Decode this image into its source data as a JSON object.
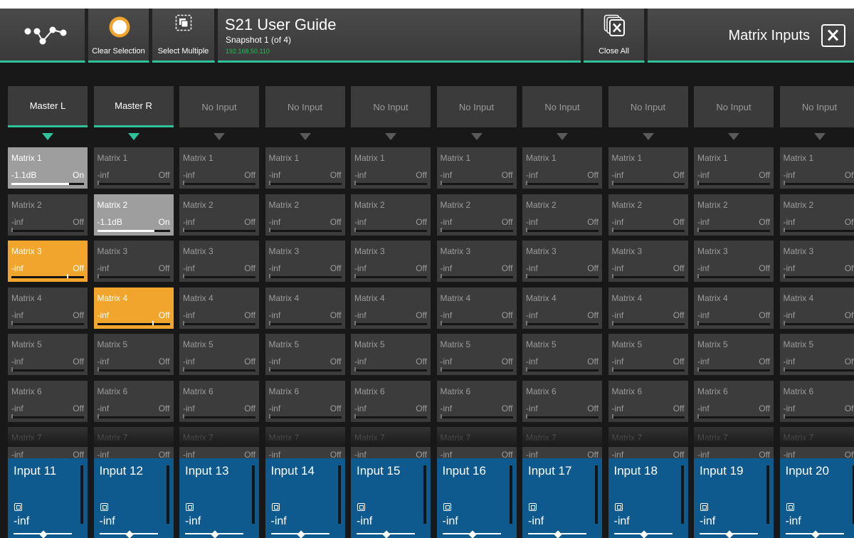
{
  "toolbar": {
    "clear_selection_label": "Clear Selection",
    "select_multiple_label": "Select Multiple",
    "close_all_label": "Close All",
    "title": "S21 User Guide",
    "snapshot": "Snapshot 1 (of 4)",
    "ip_address": "192.168.50.110",
    "panel_title": "Matrix Inputs"
  },
  "colors": {
    "accent": "#2fc39a",
    "selected": "#f2a52d",
    "input_strip": "#0e5a8f",
    "active_cell": "#9e9e9e",
    "cell": "#3c3c3c"
  },
  "icons": [
    "network-icon",
    "clear-selection-icon",
    "select-multiple-icon",
    "close-all-icon",
    "close-icon",
    "channel-icon",
    "arrow-down-icon"
  ],
  "columns": [
    {
      "master": "Master L",
      "master_active": true,
      "cells": [
        {
          "name": "Matrix 1",
          "level": "-1.1dB",
          "state": "On",
          "style": "on",
          "send": 0.79
        },
        {
          "name": "Matrix 2",
          "level": "-inf",
          "state": "Off",
          "style": "normal",
          "send": 0
        },
        {
          "name": "Matrix 3",
          "level": "-inf",
          "state": "Off",
          "style": "selected",
          "send": 0
        },
        {
          "name": "Matrix 4",
          "level": "-inf",
          "state": "Off",
          "style": "normal",
          "send": 0
        },
        {
          "name": "Matrix 5",
          "level": "-inf",
          "state": "Off",
          "style": "normal",
          "send": 0
        },
        {
          "name": "Matrix 6",
          "level": "-inf",
          "state": "Off",
          "style": "normal",
          "send": 0
        },
        {
          "name": "Matrix 7",
          "level": "-inf",
          "state": "Off",
          "style": "normal",
          "send": 0
        }
      ],
      "input": "Input 11",
      "input_level": "-inf"
    },
    {
      "master": "Master R",
      "master_active": true,
      "cells": [
        {
          "name": "Matrix 1",
          "level": "-inf",
          "state": "Off",
          "style": "normal",
          "send": 0
        },
        {
          "name": "Matrix 2",
          "level": "-1.1dB",
          "state": "On",
          "style": "on",
          "send": 0.79
        },
        {
          "name": "Matrix 3",
          "level": "-inf",
          "state": "Off",
          "style": "normal",
          "send": 0
        },
        {
          "name": "Matrix 4",
          "level": "-inf",
          "state": "Off",
          "style": "selected",
          "send": 0
        },
        {
          "name": "Matrix 5",
          "level": "-inf",
          "state": "Off",
          "style": "normal",
          "send": 0
        },
        {
          "name": "Matrix 6",
          "level": "-inf",
          "state": "Off",
          "style": "normal",
          "send": 0
        },
        {
          "name": "Matrix 7",
          "level": "-inf",
          "state": "Off",
          "style": "normal",
          "send": 0
        }
      ],
      "input": "Input 12",
      "input_level": "-inf"
    },
    {
      "master": "No Input",
      "master_active": false,
      "cells": [
        {
          "name": "Matrix 1",
          "level": "-inf",
          "state": "Off",
          "style": "normal",
          "send": 0
        },
        {
          "name": "Matrix 2",
          "level": "-inf",
          "state": "Off",
          "style": "normal",
          "send": 0
        },
        {
          "name": "Matrix 3",
          "level": "-inf",
          "state": "Off",
          "style": "normal",
          "send": 0
        },
        {
          "name": "Matrix 4",
          "level": "-inf",
          "state": "Off",
          "style": "normal",
          "send": 0
        },
        {
          "name": "Matrix 5",
          "level": "-inf",
          "state": "Off",
          "style": "normal",
          "send": 0
        },
        {
          "name": "Matrix 6",
          "level": "-inf",
          "state": "Off",
          "style": "normal",
          "send": 0
        },
        {
          "name": "Matrix 7",
          "level": "-inf",
          "state": "Off",
          "style": "normal",
          "send": 0
        }
      ],
      "input": "Input 13",
      "input_level": "-inf"
    },
    {
      "master": "No Input",
      "master_active": false,
      "cells": [
        {
          "name": "Matrix 1",
          "level": "-inf",
          "state": "Off",
          "style": "normal",
          "send": 0
        },
        {
          "name": "Matrix 2",
          "level": "-inf",
          "state": "Off",
          "style": "normal",
          "send": 0
        },
        {
          "name": "Matrix 3",
          "level": "-inf",
          "state": "Off",
          "style": "normal",
          "send": 0
        },
        {
          "name": "Matrix 4",
          "level": "-inf",
          "state": "Off",
          "style": "normal",
          "send": 0
        },
        {
          "name": "Matrix 5",
          "level": "-inf",
          "state": "Off",
          "style": "normal",
          "send": 0
        },
        {
          "name": "Matrix 6",
          "level": "-inf",
          "state": "Off",
          "style": "normal",
          "send": 0
        },
        {
          "name": "Matrix 7",
          "level": "-inf",
          "state": "Off",
          "style": "normal",
          "send": 0
        }
      ],
      "input": "Input 14",
      "input_level": "-inf"
    },
    {
      "master": "No Input",
      "master_active": false,
      "cells": [
        {
          "name": "Matrix 1",
          "level": "-inf",
          "state": "Off",
          "style": "normal",
          "send": 0
        },
        {
          "name": "Matrix 2",
          "level": "-inf",
          "state": "Off",
          "style": "normal",
          "send": 0
        },
        {
          "name": "Matrix 3",
          "level": "-inf",
          "state": "Off",
          "style": "normal",
          "send": 0
        },
        {
          "name": "Matrix 4",
          "level": "-inf",
          "state": "Off",
          "style": "normal",
          "send": 0
        },
        {
          "name": "Matrix 5",
          "level": "-inf",
          "state": "Off",
          "style": "normal",
          "send": 0
        },
        {
          "name": "Matrix 6",
          "level": "-inf",
          "state": "Off",
          "style": "normal",
          "send": 0
        },
        {
          "name": "Matrix 7",
          "level": "-inf",
          "state": "Off",
          "style": "normal",
          "send": 0
        }
      ],
      "input": "Input 15",
      "input_level": "-inf"
    },
    {
      "master": "No Input",
      "master_active": false,
      "cells": [
        {
          "name": "Matrix 1",
          "level": "-inf",
          "state": "Off",
          "style": "normal",
          "send": 0
        },
        {
          "name": "Matrix 2",
          "level": "-inf",
          "state": "Off",
          "style": "normal",
          "send": 0
        },
        {
          "name": "Matrix 3",
          "level": "-inf",
          "state": "Off",
          "style": "normal",
          "send": 0
        },
        {
          "name": "Matrix 4",
          "level": "-inf",
          "state": "Off",
          "style": "normal",
          "send": 0
        },
        {
          "name": "Matrix 5",
          "level": "-inf",
          "state": "Off",
          "style": "normal",
          "send": 0
        },
        {
          "name": "Matrix 6",
          "level": "-inf",
          "state": "Off",
          "style": "normal",
          "send": 0
        },
        {
          "name": "Matrix 7",
          "level": "-inf",
          "state": "Off",
          "style": "normal",
          "send": 0
        }
      ],
      "input": "Input 16",
      "input_level": "-inf"
    },
    {
      "master": "No Input",
      "master_active": false,
      "cells": [
        {
          "name": "Matrix 1",
          "level": "-inf",
          "state": "Off",
          "style": "normal",
          "send": 0
        },
        {
          "name": "Matrix 2",
          "level": "-inf",
          "state": "Off",
          "style": "normal",
          "send": 0
        },
        {
          "name": "Matrix 3",
          "level": "-inf",
          "state": "Off",
          "style": "normal",
          "send": 0
        },
        {
          "name": "Matrix 4",
          "level": "-inf",
          "state": "Off",
          "style": "normal",
          "send": 0
        },
        {
          "name": "Matrix 5",
          "level": "-inf",
          "state": "Off",
          "style": "normal",
          "send": 0
        },
        {
          "name": "Matrix 6",
          "level": "-inf",
          "state": "Off",
          "style": "normal",
          "send": 0
        },
        {
          "name": "Matrix 7",
          "level": "-inf",
          "state": "Off",
          "style": "normal",
          "send": 0
        }
      ],
      "input": "Input 17",
      "input_level": "-inf"
    },
    {
      "master": "No Input",
      "master_active": false,
      "cells": [
        {
          "name": "Matrix 1",
          "level": "-inf",
          "state": "Off",
          "style": "normal",
          "send": 0
        },
        {
          "name": "Matrix 2",
          "level": "-inf",
          "state": "Off",
          "style": "normal",
          "send": 0
        },
        {
          "name": "Matrix 3",
          "level": "-inf",
          "state": "Off",
          "style": "normal",
          "send": 0
        },
        {
          "name": "Matrix 4",
          "level": "-inf",
          "state": "Off",
          "style": "normal",
          "send": 0
        },
        {
          "name": "Matrix 5",
          "level": "-inf",
          "state": "Off",
          "style": "normal",
          "send": 0
        },
        {
          "name": "Matrix 6",
          "level": "-inf",
          "state": "Off",
          "style": "normal",
          "send": 0
        },
        {
          "name": "Matrix 7",
          "level": "-inf",
          "state": "Off",
          "style": "normal",
          "send": 0
        }
      ],
      "input": "Input 18",
      "input_level": "-inf"
    },
    {
      "master": "No Input",
      "master_active": false,
      "cells": [
        {
          "name": "Matrix 1",
          "level": "-inf",
          "state": "Off",
          "style": "normal",
          "send": 0
        },
        {
          "name": "Matrix 2",
          "level": "-inf",
          "state": "Off",
          "style": "normal",
          "send": 0
        },
        {
          "name": "Matrix 3",
          "level": "-inf",
          "state": "Off",
          "style": "normal",
          "send": 0
        },
        {
          "name": "Matrix 4",
          "level": "-inf",
          "state": "Off",
          "style": "normal",
          "send": 0
        },
        {
          "name": "Matrix 5",
          "level": "-inf",
          "state": "Off",
          "style": "normal",
          "send": 0
        },
        {
          "name": "Matrix 6",
          "level": "-inf",
          "state": "Off",
          "style": "normal",
          "send": 0
        },
        {
          "name": "Matrix 7",
          "level": "-inf",
          "state": "Off",
          "style": "normal",
          "send": 0
        }
      ],
      "input": "Input 19",
      "input_level": "-inf"
    },
    {
      "master": "No Input",
      "master_active": false,
      "cells": [
        {
          "name": "Matrix 1",
          "level": "-inf",
          "state": "Off",
          "style": "normal",
          "send": 0
        },
        {
          "name": "Matrix 2",
          "level": "-inf",
          "state": "Off",
          "style": "normal",
          "send": 0
        },
        {
          "name": "Matrix 3",
          "level": "-inf",
          "state": "Off",
          "style": "normal",
          "send": 0
        },
        {
          "name": "Matrix 4",
          "level": "-inf",
          "state": "Off",
          "style": "normal",
          "send": 0
        },
        {
          "name": "Matrix 5",
          "level": "-inf",
          "state": "Off",
          "style": "normal",
          "send": 0
        },
        {
          "name": "Matrix 6",
          "level": "-inf",
          "state": "Off",
          "style": "normal",
          "send": 0
        },
        {
          "name": "Matrix 7",
          "level": "-inf",
          "state": "Off",
          "style": "normal",
          "send": 0
        }
      ],
      "input": "Input 20",
      "input_level": "-inf"
    }
  ]
}
